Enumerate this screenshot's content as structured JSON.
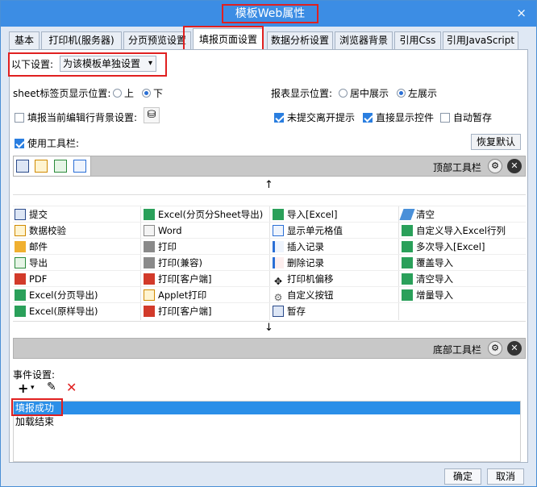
{
  "window": {
    "title": "模板Web属性",
    "close": "×"
  },
  "tabs": [
    {
      "label": "基本"
    },
    {
      "label": "打印机(服务器)"
    },
    {
      "label": "分页预览设置"
    },
    {
      "label": "填报页面设置"
    },
    {
      "label": "数据分析设置"
    },
    {
      "label": "浏览器背景"
    },
    {
      "label": "引用Css"
    },
    {
      "label": "引用JavaScript"
    }
  ],
  "settings": {
    "label": "以下设置:",
    "select_value": "为该模板单独设置",
    "sheet_pos_label": "sheet标签页显示位置:",
    "sheet_pos_options": [
      "上",
      "下"
    ],
    "sheet_pos_selected": "下",
    "report_pos_label": "报表显示位置:",
    "report_pos_options": [
      "居中展示",
      "左展示"
    ],
    "report_pos_selected": "左展示",
    "fill_bg_label": "填报当前编辑行背景设置:",
    "fill_bg_checked": false,
    "unsubmitted_label": "未提交离开提示",
    "unsubmitted_checked": true,
    "direct_widget_label": "直接显示控件",
    "direct_widget_checked": true,
    "autosave_label": "自动暂存",
    "autosave_checked": false,
    "use_toolbar_label": "使用工具栏:",
    "use_toolbar_checked": true,
    "restore_default": "恢复默认"
  },
  "toolbars": {
    "top_label": "顶部工具栏",
    "bottom_label": "底部工具栏",
    "up_arrow": "↑",
    "down_arrow": "↓"
  },
  "buttons_grid": [
    [
      "提交",
      "Excel(分页分Sheet导出)",
      "导入[Excel]",
      "清空"
    ],
    [
      "数据校验",
      "Word",
      "显示单元格值",
      "自定义导入Excel行列"
    ],
    [
      "邮件",
      "打印",
      "插入记录",
      "多次导入[Excel]"
    ],
    [
      "导出",
      "打印(兼容)",
      "删除记录",
      "覆盖导入"
    ],
    [
      "PDF",
      "打印[客户端]",
      "打印机偏移",
      "清空导入"
    ],
    [
      "Excel(分页导出)",
      "Applet打印",
      "自定义按钮",
      "增量导入"
    ],
    [
      "Excel(原样导出)",
      "打印[客户端]",
      "暂存",
      ""
    ]
  ],
  "events": {
    "label": "事件设置:",
    "items": [
      "填报成功",
      "加载结束"
    ],
    "selected_index": 0
  },
  "footer": {
    "ok": "确定",
    "cancel": "取消"
  },
  "colors": {
    "titlebar": "#3c8de4",
    "highlight": "#e02020",
    "selection": "#2b8fe8"
  }
}
